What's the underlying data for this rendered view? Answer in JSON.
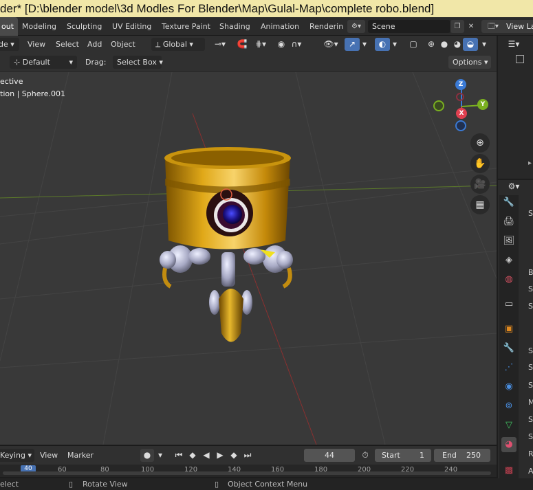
{
  "window": {
    "title": "der* [D:\\blender model\\3d Modles For Blender\\Map\\Gulal-Map\\complete robo.blend]"
  },
  "tabs": [
    "out",
    "Modeling",
    "Sculpting",
    "UV Editing",
    "Texture Paint",
    "Shading",
    "Animation",
    "Renderin"
  ],
  "scene": {
    "name": "Scene",
    "view_layer": "View La"
  },
  "header": {
    "mode": "de",
    "menus": [
      "View",
      "Select",
      "Add",
      "Object"
    ],
    "orientation": "Global",
    "pivot_default": "Default",
    "drag_label": "Drag:",
    "drag_value": "Select Box",
    "options": "Options"
  },
  "viewport": {
    "view_name": "ective",
    "collection_info": "tion | Sphere.001",
    "gizmo_axes": [
      "Z",
      "X",
      "Y"
    ]
  },
  "timeline": {
    "keying": "Keying",
    "view": "View",
    "marker": "Marker",
    "current_frame": "44",
    "start_label": "Start",
    "start": "1",
    "end_label": "End",
    "end": "250",
    "ticks": [
      "40",
      "60",
      "80",
      "100",
      "120",
      "140",
      "160",
      "180",
      "200",
      "220",
      "240"
    ]
  },
  "properties": {
    "labels": [
      "S",
      "B",
      "S",
      "S",
      "S",
      "S",
      "S",
      "M",
      "S",
      "S",
      "R",
      "A"
    ]
  },
  "statusbar": {
    "select": "elect",
    "rotate": "Rotate View",
    "context": "Object Context Menu"
  },
  "colors": {
    "accent": "#4772b3",
    "title_bg": "#f1e7a8",
    "gold": "#d4a017"
  }
}
